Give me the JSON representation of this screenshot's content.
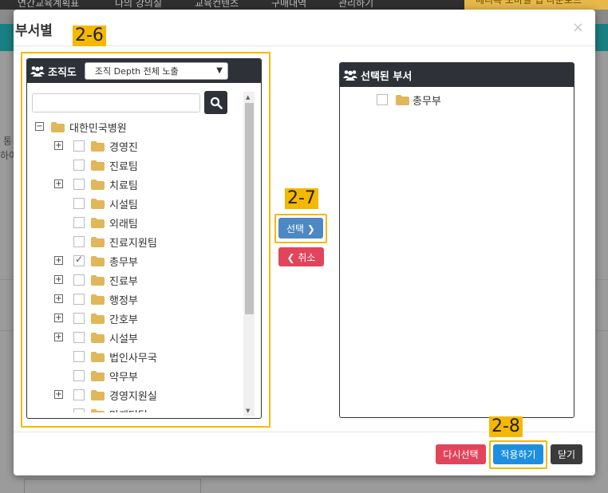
{
  "background": {
    "nav_items": [
      "연간교육계획표",
      "나의 강의실",
      "교육컨텐츠",
      "구매내역",
      "관리하기"
    ],
    "mobile_banner": "메디톡 모바일 앱 다운로드",
    "side_text_1": "통",
    "side_text_2": "하여"
  },
  "modal": {
    "title": "부서별",
    "close_symbol": "×"
  },
  "tags": {
    "left_panel": "2-6",
    "select_button": "2-7",
    "apply_button": "2-8"
  },
  "left_panel": {
    "header": "조직도",
    "depth_select_value": "조직 Depth 전체 노출",
    "search_placeholder": "",
    "tree": [
      {
        "label": "대한민국병원",
        "level": 0,
        "expander": "minus",
        "checkbox": false,
        "checked": false
      },
      {
        "label": "경영진",
        "level": 1,
        "expander": "plus",
        "checkbox": true,
        "checked": false
      },
      {
        "label": "진료팀",
        "level": 1,
        "expander": "",
        "checkbox": true,
        "checked": false
      },
      {
        "label": "치료팀",
        "level": 1,
        "expander": "plus",
        "checkbox": true,
        "checked": false
      },
      {
        "label": "시설팀",
        "level": 1,
        "expander": "",
        "checkbox": true,
        "checked": false
      },
      {
        "label": "외래팀",
        "level": 1,
        "expander": "",
        "checkbox": true,
        "checked": false
      },
      {
        "label": "진료지원팀",
        "level": 1,
        "expander": "",
        "checkbox": true,
        "checked": false
      },
      {
        "label": "총무부",
        "level": 1,
        "expander": "plus",
        "checkbox": true,
        "checked": true
      },
      {
        "label": "진료부",
        "level": 1,
        "expander": "plus",
        "checkbox": true,
        "checked": false
      },
      {
        "label": "행정부",
        "level": 1,
        "expander": "plus",
        "checkbox": true,
        "checked": false
      },
      {
        "label": "간호부",
        "level": 1,
        "expander": "plus",
        "checkbox": true,
        "checked": false
      },
      {
        "label": "시설부",
        "level": 1,
        "expander": "plus",
        "checkbox": true,
        "checked": false
      },
      {
        "label": "법인사무국",
        "level": 1,
        "expander": "",
        "checkbox": true,
        "checked": false
      },
      {
        "label": "약무부",
        "level": 1,
        "expander": "",
        "checkbox": true,
        "checked": false
      },
      {
        "label": "경영지원실",
        "level": 1,
        "expander": "plus",
        "checkbox": true,
        "checked": false
      },
      {
        "label": "마케팅팀",
        "level": 1,
        "expander": "",
        "checkbox": true,
        "checked": false
      }
    ]
  },
  "middle": {
    "select_label": "선택 ❯",
    "cancel_label": "❮ 취소"
  },
  "right_panel": {
    "header": "선택된 부서",
    "items": [
      {
        "label": "총무부",
        "checked": false
      }
    ]
  },
  "footer": {
    "reselect_label": "다시선택",
    "apply_label": "적용하기",
    "close_label": "닫기"
  },
  "colors": {
    "panel_header": "#2e3238",
    "tag_yellow": "#f5b800",
    "select_blue": "#4d88c4",
    "cancel_red": "#e2445c",
    "apply_blue": "#1e8fe0",
    "close_dark": "#3b3b3b",
    "folder_gold": "#e0b75a"
  }
}
